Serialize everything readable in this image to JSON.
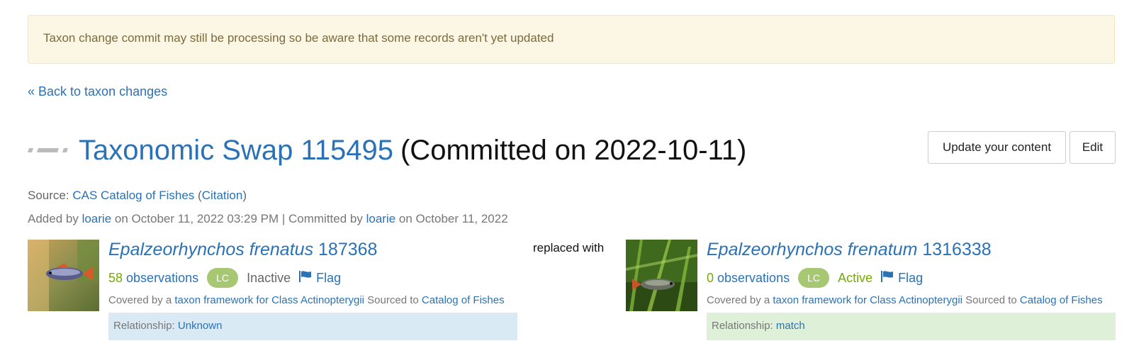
{
  "notice": {
    "text": "Taxon change commit may still be processing so be aware that some records aren't yet updated"
  },
  "back_link": {
    "label": "« Back to taxon changes"
  },
  "header": {
    "title_link": "Taxonomic Swap 115495",
    "title_rest": "(Committed on 2022-10-11)",
    "icon": "swap-icon",
    "buttons": {
      "update_label": "Update your content",
      "edit_label": "Edit"
    }
  },
  "source": {
    "prefix": "Source:",
    "name": "CAS Catalog of Fishes",
    "open_paren": "(",
    "citation": "Citation",
    "close_paren": ")"
  },
  "added": {
    "added_by": "Added by",
    "user1": "loarie",
    "date1": "on October 11, 2022 03:29 PM | Committed by",
    "user2": "loarie",
    "date2": "on October 11, 2022"
  },
  "replaced_text": "replaced with",
  "old_taxon": {
    "name": "Epalzeorhynchos frenatus",
    "id": "187368",
    "obs_count": "58",
    "obs_label": "observations",
    "status_badge": "LC",
    "status": "Inactive",
    "flag_label": "Flag",
    "covered_prefix": "Covered by a",
    "framework": "taxon framework for Class Actinopterygii",
    "sourced_to": "Sourced to",
    "source": "Catalog of Fishes",
    "relationship_label": "Relationship:",
    "relationship": "Unknown"
  },
  "new_taxon": {
    "name": "Epalzeorhynchos frenatum",
    "id": "1316338",
    "obs_count": "0",
    "obs_label": "observations",
    "status_badge": "LC",
    "status": "Active",
    "flag_label": "Flag",
    "covered_prefix": "Covered by a",
    "framework": "taxon framework for Class Actinopterygii",
    "sourced_to": "Sourced to",
    "source": "Catalog of Fishes",
    "relationship_label": "Relationship:",
    "relationship": "match"
  },
  "colors": {
    "link": "#2a72b5",
    "observations": "#74ac00",
    "badge": "#a7c773",
    "unknown_bg": "#d9eaf5",
    "match_bg": "#dff0d8",
    "notice_bg": "#fcf7e4"
  }
}
